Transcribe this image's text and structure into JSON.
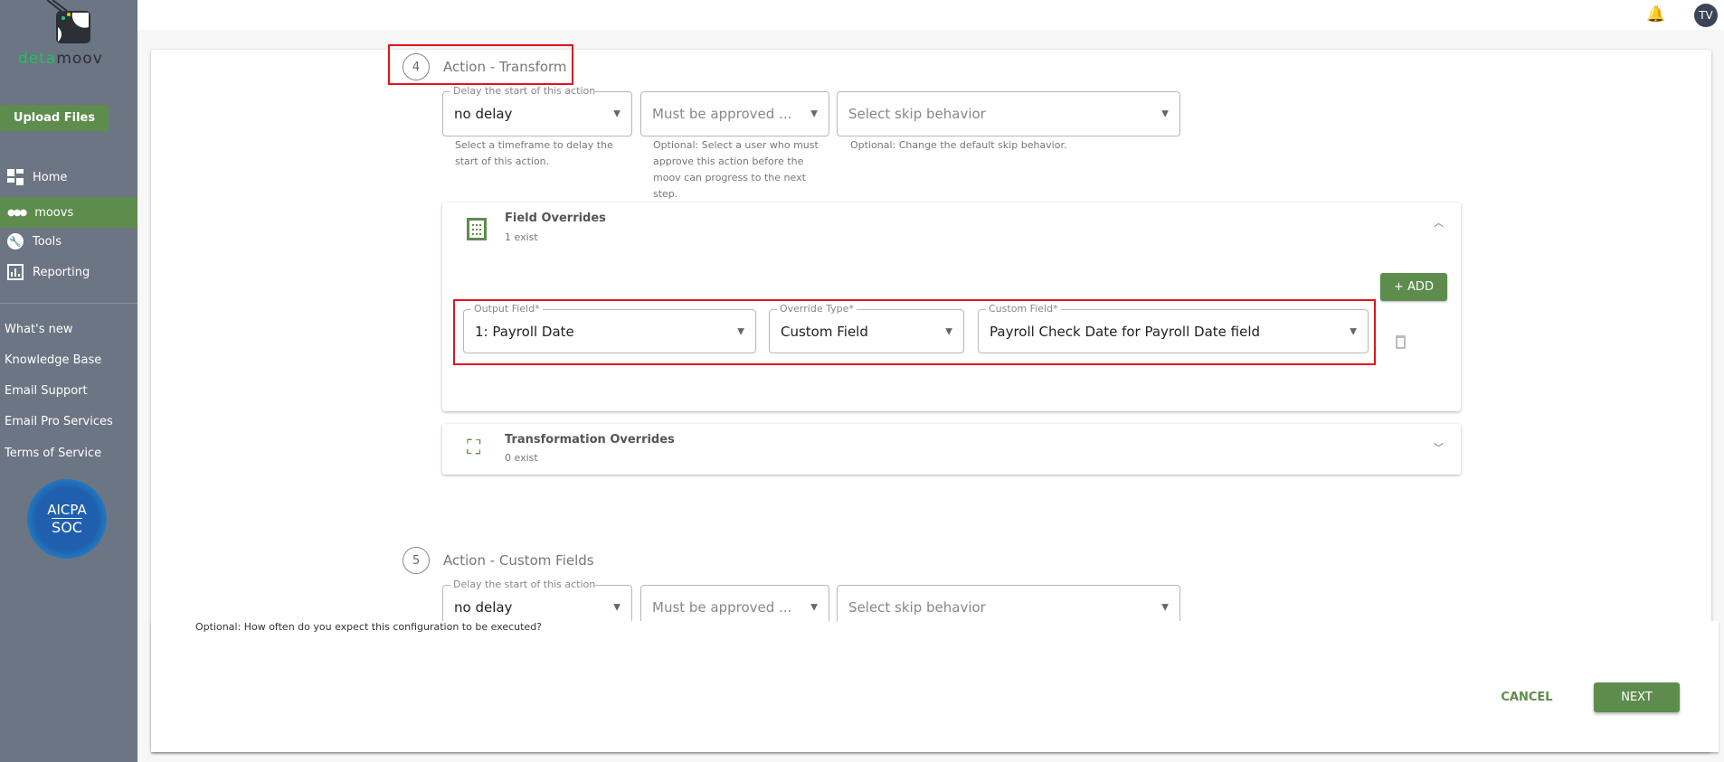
{
  "sidebar": {
    "logo_text_green": "deta",
    "logo_text_dark": "moov",
    "upload_label": "Upload Files",
    "nav": [
      {
        "label": "Home",
        "icon": "dashboard-icon"
      },
      {
        "label": "moovs",
        "icon": "dots-icon",
        "active": true
      },
      {
        "label": "Tools",
        "icon": "wrench-icon"
      },
      {
        "label": "Reporting",
        "icon": "chart-icon"
      }
    ],
    "links": [
      "What's new",
      "Knowledge Base",
      "Email Support",
      "Email Pro Services",
      "Terms of Service"
    ],
    "badge": {
      "line1": "AICPA",
      "line2": "SOC"
    }
  },
  "header": {
    "avatar": "TV"
  },
  "step4": {
    "number": "4",
    "title": "Action - Transform",
    "delay": {
      "label": "Delay the start of this action",
      "value": "no delay",
      "help": "Select a timeframe to delay the start of this action."
    },
    "approve": {
      "placeholder": "Must be approved ...",
      "help": "Optional: Select a user who must approve this action before the moov can progress to the next step."
    },
    "skip": {
      "placeholder": "Select skip behavior",
      "help": "Optional: Change the default skip behavior."
    },
    "field_overrides": {
      "title": "Field Overrides",
      "count": "1 exist",
      "add_label": "+ ADD",
      "row": {
        "output": {
          "label": "Output Field*",
          "value": "1: Payroll Date"
        },
        "type": {
          "label": "Override Type*",
          "value": "Custom Field"
        },
        "custom": {
          "label": "Custom Field*",
          "value": "Payroll Check Date for Payroll Date field"
        }
      }
    },
    "transformation_overrides": {
      "title": "Transformation Overrides",
      "count": "0 exist"
    }
  },
  "step5": {
    "number": "5",
    "title": "Action - Custom Fields",
    "delay": {
      "label": "Delay the start of this action",
      "value": "no delay"
    },
    "approve": {
      "placeholder": "Must be approved ..."
    },
    "skip": {
      "placeholder": "Select skip behavior"
    }
  },
  "footer": {
    "note": "Optional: How often do you expect this configuration to be executed?",
    "cancel": "CANCEL",
    "next": "NEXT"
  },
  "colors": {
    "brand_green": "#5e8c4d",
    "sidebar": "#6c7583",
    "highlight": "#e0141e"
  }
}
